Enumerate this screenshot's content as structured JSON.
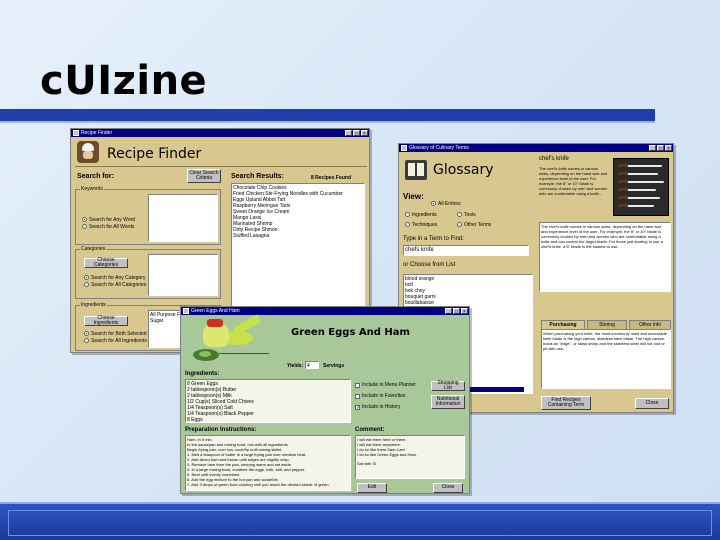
{
  "slide": {
    "title": "cUIzine"
  },
  "recipe_finder": {
    "window_title": "Recipe Finder",
    "header_title": "Recipe Finder",
    "search_for_label": "Search for:",
    "clear_search_button": "Clear Search Criteria",
    "keywords_group": "Keywords",
    "keyword_radio_any": "Search for Any Word",
    "keyword_radio_all": "Search for All Words",
    "categories_group": "Categories",
    "choose_categories_button": "Choose Categories",
    "category_radio_any": "Search for Any Category",
    "category_radio_all": "Search for All Categories",
    "ingredients_group": "Ingredients",
    "choose_ingredients_button": "Choose Ingredients",
    "ingredient_radio_match": "Search for Both Selected",
    "ingredient_radio_any": "Search for All Ingredients",
    "ingredient_list": [
      "All Purpose Flour",
      "Sugar"
    ],
    "search_results_label": "Search Results:",
    "recipes_found": "8 Recipes Found",
    "results": [
      "Chocolate Chip Cookies",
      "Fried Chicken Stir-Frying Noodles with Cucumber",
      "Eggs Upland Abbot Tart",
      "Raspberry Meringue Tarts",
      "Sweet Orange Ice Cream",
      "Mango Lassi",
      "Marinated Shrimp",
      "Dirty Recipe Shmoo",
      "Stuffed Lasagna"
    ]
  },
  "glossary": {
    "window_title": "Glossary of Culinary Terms",
    "header_title": "Glossary",
    "term_title": "chef's knife",
    "term_definition_top": "The chef's knife comes in various sizes, depending on the hand size and experience level of the user. For example, the 8\" or 10\" blade is commonly chosen by men and women who are comfortable using a knife...",
    "view_label": "View:",
    "view_options": [
      "All Entries",
      "Ingredients",
      "Tools",
      "Techniques",
      "Other Terms"
    ],
    "view_selected": 0,
    "term_search_label": "Type in a Term to Find:",
    "term_search_value": "chefs knife",
    "choose_list_label": "or Choose from List",
    "term_list": [
      "blood orange",
      "boil",
      "bok choy",
      "bouquet garni",
      "bouillabaisse",
      "braise"
    ],
    "definition_box": "The chef's knife comes in various sizes, depending on the hand size and experience level of the user. For example, the 8\" or 10\" blade is commonly chosen by men and women who are comfortable using a knife and can control the larger blade. For those just starting to use a chef's knife, a 6\" blade is the easiest to use.",
    "tabs": [
      "Purchasing",
      "Storing",
      "Other info"
    ],
    "active_tab": 0,
    "tab_content": "When purchasing your knife, the most commonly used and accessible knife blade is the high carbon, stainless steel blade. The high carbon holds an \"edge\", or stays sharp and the stainless steel will not rust or pit with use.",
    "find_recipes_button": "Find Recipes Containing Term",
    "close_button": "Close"
  },
  "green_eggs": {
    "window_title": "Green Eggs And Ham",
    "header_title": "Green Eggs And Ham",
    "yields_label": "Yields:",
    "yields_value": "4",
    "servings_label": "Servings",
    "ingredients_label": "Ingredients:",
    "ingredients": [
      "8 Green Eggs",
      "2 tablespoon(s) Butter",
      "2 tablespoon(s) Milk",
      "1/2 Cup(s) Sliced Cold Chives",
      "1/4 Teaspoon(s) Salt",
      "1/4 Teaspoon(s) Black Pepper",
      "8 Eggs"
    ],
    "checks": [
      {
        "label": "Include in Menu Planner",
        "checked": false
      },
      {
        "label": "Include in Favorites",
        "checked": false
      },
      {
        "label": "Include in History",
        "checked": true
      }
    ],
    "shopping_list_button": "Shopping List",
    "nutritional_button": "Nutritional Information",
    "prep_label": "Preparation Instructions:",
    "prep_lines": [
      "Ham, in 5 min",
      "In the saucepan and mixing bowl, mix with all ingredients.",
      "Begin frying pan, over low, cook/fry until mixing skillet.",
      "",
      "1. Melt a teaspoon of butter in a large frying pan over medium heat.",
      "2. Add sliced ham and brown until edges are slightly crisp.",
      "3. Remove ham from the pan, keeping warm and set aside.",
      "4. In a large mixing bowl, combine the eggs, milk, salt, and pepper.",
      "5. Beat until evenly combined.",
      "6. Add the egg mixture to the hot pan and scramble.",
      "7. Add 3 drops of green food coloring until you reach the desired shade of green."
    ],
    "comment_label": "Comment:",
    "comment_lines": [
      "I will eat them here or there.",
      "I will eat them anywhere.",
      "I do so like them Sam-I-am",
      "I do so like Green Eggs and Ham."
    ],
    "comment_signoff": "Sat with Sl",
    "edit_button": "Edit",
    "close_button": "Close"
  },
  "colors": {
    "title_rule": "#1f3fa8",
    "window_title_bar": "#000080",
    "recipe_bg": "#d8c890",
    "green_eggs_bg": "#a8c89a",
    "green_accent": "#c8e04a"
  }
}
